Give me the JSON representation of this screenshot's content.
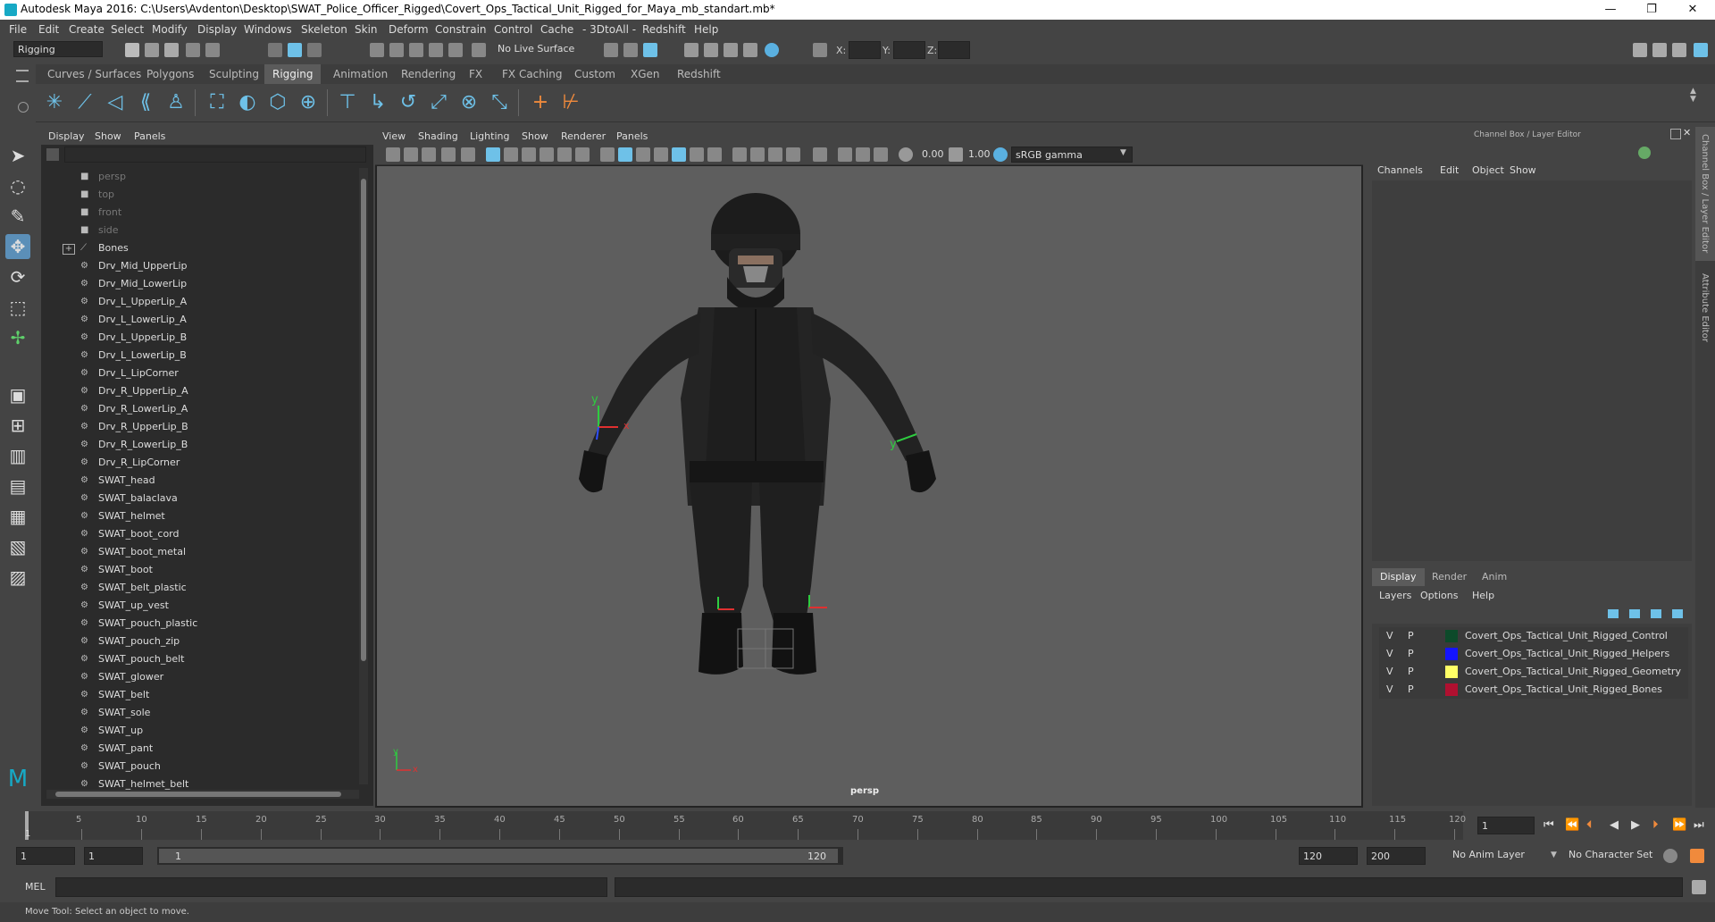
{
  "window": {
    "title": "Autodesk Maya 2016: C:\\Users\\Avdenton\\Desktop\\SWAT_Police_Officer_Rigged\\Covert_Ops_Tactical_Unit_Rigged_for_Maya_mb_standart.mb*",
    "minimize": "—",
    "maximize": "❐",
    "close": "✕"
  },
  "menubar": [
    "File",
    "Edit",
    "Create",
    "Select",
    "Modify",
    "Display",
    "Windows",
    "Skeleton",
    "Skin",
    "Deform",
    "Constrain",
    "Control",
    "Cache",
    "- 3DtoAll -",
    "Redshift",
    "Help"
  ],
  "statusline": {
    "menuset": "Rigging",
    "live_surface": "No Live Surface",
    "x_label": "X:",
    "y_label": "Y:",
    "z_label": "Z:"
  },
  "shelf": {
    "tabs": [
      "Curves / Surfaces",
      "Polygons",
      "Sculpting",
      "Rigging",
      "Animation",
      "Rendering",
      "FX",
      "FX Caching",
      "Custom",
      "XGen",
      "Redshift"
    ],
    "active_tab": "Rigging"
  },
  "outliner": {
    "menu": [
      "Display",
      "Show",
      "Panels"
    ],
    "items": [
      {
        "label": "persp",
        "type": "camera",
        "dim": true
      },
      {
        "label": "top",
        "type": "camera",
        "dim": true
      },
      {
        "label": "front",
        "type": "camera",
        "dim": true
      },
      {
        "label": "side",
        "type": "camera",
        "dim": true
      },
      {
        "label": "Bones",
        "type": "joint",
        "dim": false
      },
      {
        "label": "Drv_Mid_UpperLip",
        "type": "mesh",
        "dim": false
      },
      {
        "label": "Drv_Mid_LowerLip",
        "type": "mesh",
        "dim": false
      },
      {
        "label": "Drv_L_UpperLip_A",
        "type": "mesh",
        "dim": false
      },
      {
        "label": "Drv_L_LowerLip_A",
        "type": "mesh",
        "dim": false
      },
      {
        "label": "Drv_L_UpperLip_B",
        "type": "mesh",
        "dim": false
      },
      {
        "label": "Drv_L_LowerLip_B",
        "type": "mesh",
        "dim": false
      },
      {
        "label": "Drv_L_LipCorner",
        "type": "mesh",
        "dim": false
      },
      {
        "label": "Drv_R_UpperLip_A",
        "type": "mesh",
        "dim": false
      },
      {
        "label": "Drv_R_LowerLip_A",
        "type": "mesh",
        "dim": false
      },
      {
        "label": "Drv_R_UpperLip_B",
        "type": "mesh",
        "dim": false
      },
      {
        "label": "Drv_R_LowerLip_B",
        "type": "mesh",
        "dim": false
      },
      {
        "label": "Drv_R_LipCorner",
        "type": "mesh",
        "dim": false
      },
      {
        "label": "SWAT_head",
        "type": "mesh",
        "dim": false
      },
      {
        "label": "SWAT_balaclava",
        "type": "mesh",
        "dim": false
      },
      {
        "label": "SWAT_helmet",
        "type": "mesh",
        "dim": false
      },
      {
        "label": "SWAT_boot_cord",
        "type": "mesh",
        "dim": false
      },
      {
        "label": "SWAT_boot_metal",
        "type": "mesh",
        "dim": false
      },
      {
        "label": "SWAT_boot",
        "type": "mesh",
        "dim": false
      },
      {
        "label": "SWAT_belt_plastic",
        "type": "mesh",
        "dim": false
      },
      {
        "label": "SWAT_up_vest",
        "type": "mesh",
        "dim": false
      },
      {
        "label": "SWAT_pouch_plastic",
        "type": "mesh",
        "dim": false
      },
      {
        "label": "SWAT_pouch_zip",
        "type": "mesh",
        "dim": false
      },
      {
        "label": "SWAT_pouch_belt",
        "type": "mesh",
        "dim": false
      },
      {
        "label": "SWAT_glower",
        "type": "mesh",
        "dim": false
      },
      {
        "label": "SWAT_belt",
        "type": "mesh",
        "dim": false
      },
      {
        "label": "SWAT_sole",
        "type": "mesh",
        "dim": false
      },
      {
        "label": "SWAT_up",
        "type": "mesh",
        "dim": false
      },
      {
        "label": "SWAT_pant",
        "type": "mesh",
        "dim": false
      },
      {
        "label": "SWAT_pouch",
        "type": "mesh",
        "dim": false
      },
      {
        "label": "SWAT_helmet_belt",
        "type": "mesh",
        "dim": false
      }
    ]
  },
  "viewport": {
    "menu": [
      "View",
      "Shading",
      "Lighting",
      "Show",
      "Renderer",
      "Panels"
    ],
    "exposure": "0.00",
    "gamma": "1.00",
    "color_space": "sRGB gamma",
    "camera_label": "persp",
    "axis_y": "y",
    "axis_x": "x"
  },
  "channel_box": {
    "title": "Channel Box / Layer Editor",
    "menu": [
      "Channels",
      "Edit",
      "Object",
      "Show"
    ]
  },
  "layer_editor": {
    "tabs": [
      "Display",
      "Render",
      "Anim"
    ],
    "active_tab": "Display",
    "menu": [
      "Layers",
      "Options",
      "Help"
    ],
    "layers": [
      {
        "v": "V",
        "p": "P",
        "color": "#0d4a2a",
        "name": "Covert_Ops_Tactical_Unit_Rigged_Control"
      },
      {
        "v": "V",
        "p": "P",
        "color": "#1414ff",
        "name": "Covert_Ops_Tactical_Unit_Rigged_Helpers"
      },
      {
        "v": "V",
        "p": "P",
        "color": "#ffff66",
        "name": "Covert_Ops_Tactical_Unit_Rigged_Geometry"
      },
      {
        "v": "V",
        "p": "P",
        "color": "#b01030",
        "name": "Covert_Ops_Tactical_Unit_Rigged_Bones"
      }
    ]
  },
  "side_tabs": [
    "Channel Box / Layer Editor",
    "Attribute Editor"
  ],
  "timeline": {
    "ticks": [
      "5",
      "10",
      "15",
      "20",
      "25",
      "30",
      "35",
      "40",
      "45",
      "50",
      "55",
      "60",
      "65",
      "70",
      "75",
      "80",
      "85",
      "90",
      "95",
      "100",
      "105",
      "110",
      "115",
      "120"
    ],
    "start_tick": "1",
    "current_frame": "1"
  },
  "range": {
    "start": "1",
    "playback_start": "1",
    "slider_start": "1",
    "slider_end": "120",
    "playback_end": "120",
    "end": "200",
    "anim_layer": "No Anim Layer",
    "character_set": "No Character Set"
  },
  "command_line": {
    "label": "MEL"
  },
  "help_line": "Move Tool: Select an object to move."
}
